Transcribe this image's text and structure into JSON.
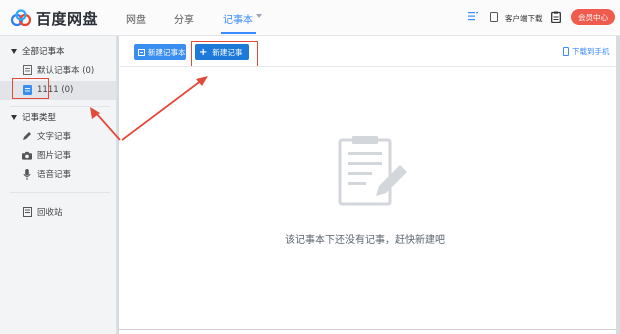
{
  "header": {
    "brand": "百度网盘",
    "nav": [
      {
        "label": "网盘"
      },
      {
        "label": "分享"
      },
      {
        "label": "记事本"
      }
    ],
    "client_label": "客户端下载",
    "vip_label": "会员中心",
    "accent": "#3b8cff"
  },
  "sidebar": {
    "all_notebooks": "全部记事本",
    "notebooks": [
      {
        "label": "默认记事本 (0)"
      },
      {
        "label": "1111 (0)"
      }
    ],
    "note_types": "记事类型",
    "types": [
      {
        "label": "文字记事",
        "icon": "pencil-icon"
      },
      {
        "label": "图片记事",
        "icon": "camera-icon"
      },
      {
        "label": "语音记事",
        "icon": "microphone-icon"
      }
    ],
    "recycle_bin": "回收站"
  },
  "toolbar": {
    "new_notebook": "新建记事本",
    "new_note": "新建记事",
    "download_mobile": "下载到手机"
  },
  "main": {
    "empty_message": "该记事本下还没有记事，赶快新建吧"
  },
  "annotation_color": "#e34a3c"
}
